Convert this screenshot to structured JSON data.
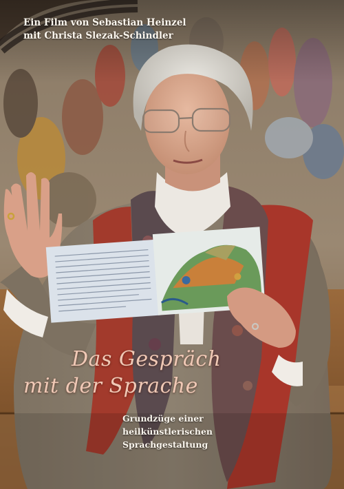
{
  "poster": {
    "credits": [
      "Ein Film von Sebastian Heinzel",
      "mit Christa Slezak-Schindler"
    ],
    "title_lines": [
      "Das Gespräch",
      "mit der Sprache"
    ],
    "subtitle_lines": [
      "Grundzüge einer",
      "heilkünstlerischen",
      "Sprachgestaltung"
    ],
    "colors": {
      "title": "#f0c9b6",
      "credits": "#fbf6ee"
    }
  }
}
